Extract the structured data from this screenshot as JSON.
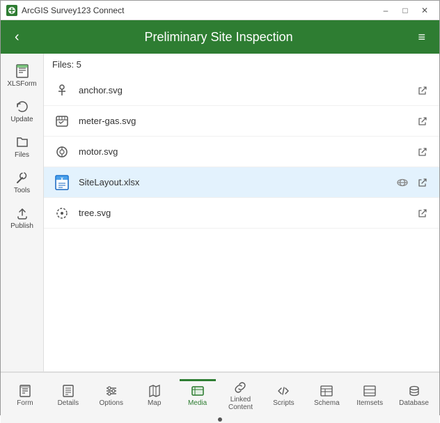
{
  "titlebar": {
    "title": "ArcGIS Survey123 Connect",
    "minimize": "–",
    "maximize": "□",
    "close": "✕"
  },
  "header": {
    "back_label": "‹",
    "title": "Preliminary Site Inspection",
    "menu_label": "≡"
  },
  "sidebar": {
    "items": [
      {
        "id": "xlsform",
        "icon": "table",
        "label": "XLSForm"
      },
      {
        "id": "update",
        "icon": "refresh",
        "label": "Update"
      },
      {
        "id": "files",
        "icon": "folder",
        "label": "Files"
      },
      {
        "id": "tools",
        "icon": "wrench",
        "label": "Tools"
      },
      {
        "id": "publish",
        "icon": "cloud",
        "label": "Publish"
      }
    ]
  },
  "content": {
    "files_header": "Files: 5",
    "files": [
      {
        "id": "anchor",
        "name": "anchor.svg",
        "type": "svg",
        "icon_color": "#555"
      },
      {
        "id": "meter-gas",
        "name": "meter-gas.svg",
        "type": "svg",
        "icon_color": "#555"
      },
      {
        "id": "motor",
        "name": "motor.svg",
        "type": "svg",
        "icon_color": "#555"
      },
      {
        "id": "sitelayout",
        "name": "SiteLayout.xlsx",
        "type": "xlsx",
        "icon_color": "#1565c0",
        "highlight": true
      },
      {
        "id": "tree",
        "name": "tree.svg",
        "type": "svg",
        "icon_color": "#555"
      }
    ]
  },
  "tabs": {
    "items": [
      {
        "id": "form",
        "label": "Form",
        "active": false
      },
      {
        "id": "details",
        "label": "Details",
        "active": false
      },
      {
        "id": "options",
        "label": "Options",
        "active": false
      },
      {
        "id": "map",
        "label": "Map",
        "active": false
      },
      {
        "id": "media",
        "label": "Media",
        "active": true
      },
      {
        "id": "linked-content",
        "label": "Linked\nContent",
        "active": false
      },
      {
        "id": "scripts",
        "label": "Scripts",
        "active": false
      },
      {
        "id": "schema",
        "label": "Schema",
        "active": false
      },
      {
        "id": "itemsets",
        "label": "Itemsets",
        "active": false
      },
      {
        "id": "database",
        "label": "Database",
        "active": false
      }
    ]
  }
}
